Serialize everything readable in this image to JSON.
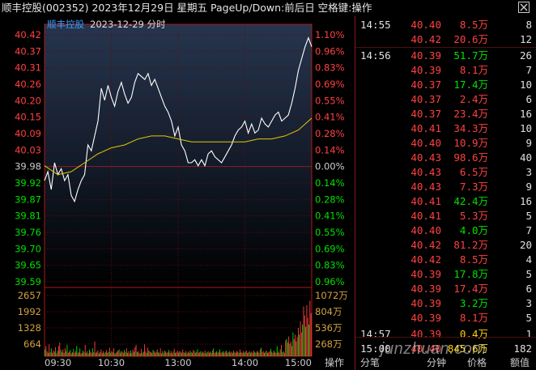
{
  "window": {
    "title": "顺丰控股(002352) 2023年12月29日 星期五 PageUp/Down:前后日 空格键:操作"
  },
  "chart_header": {
    "stock_name": "顺丰控股",
    "date_label": "2023-12-29 分时"
  },
  "chart_data": {
    "type": "line",
    "y_price_ticks": [
      "40.42",
      "40.37",
      "40.31",
      "40.26",
      "40.20",
      "40.15",
      "40.09",
      "40.03",
      "39.98",
      "39.92",
      "39.87",
      "39.81",
      "39.76",
      "39.70",
      "39.65",
      "39.59"
    ],
    "y_pct_ticks": [
      "1.10%",
      "0.96%",
      "0.83%",
      "0.69%",
      "0.55%",
      "0.41%",
      "0.28%",
      "0.14%",
      "0.00%",
      "0.14%",
      "0.28%",
      "0.41%",
      "0.55%",
      "0.69%",
      "0.83%",
      "0.96%"
    ],
    "ylim": [
      39.54,
      40.42
    ],
    "prev_close": 39.98,
    "x_ticks": [
      "09:30",
      "10:30",
      "13:00",
      "14:00",
      "15:00"
    ],
    "vol_left_ticks": [
      "2657",
      "1992",
      "1328",
      "664"
    ],
    "vol_right_ticks": [
      "1072万",
      "804万",
      "536万",
      "268万"
    ],
    "price_series": [
      [
        0,
        39.93
      ],
      [
        3,
        39.96
      ],
      [
        6,
        39.9
      ],
      [
        9,
        39.99
      ],
      [
        12,
        39.95
      ],
      [
        15,
        39.97
      ],
      [
        18,
        39.93
      ],
      [
        21,
        39.95
      ],
      [
        24,
        39.88
      ],
      [
        27,
        39.86
      ],
      [
        30,
        39.9
      ],
      [
        33,
        39.93
      ],
      [
        36,
        39.95
      ],
      [
        39,
        40.05
      ],
      [
        42,
        40.03
      ],
      [
        45,
        40.08
      ],
      [
        48,
        40.13
      ],
      [
        51,
        40.24
      ],
      [
        54,
        40.2
      ],
      [
        57,
        40.25
      ],
      [
        60,
        40.21
      ],
      [
        63,
        40.18
      ],
      [
        66,
        40.23
      ],
      [
        69,
        40.26
      ],
      [
        72,
        40.22
      ],
      [
        75,
        40.19
      ],
      [
        78,
        40.21
      ],
      [
        81,
        40.26
      ],
      [
        84,
        40.29
      ],
      [
        87,
        40.28
      ],
      [
        90,
        40.27
      ],
      [
        93,
        40.29
      ],
      [
        96,
        40.25
      ],
      [
        99,
        40.27
      ],
      [
        102,
        40.24
      ],
      [
        105,
        40.21
      ],
      [
        108,
        40.18
      ],
      [
        111,
        40.16
      ],
      [
        114,
        40.13
      ],
      [
        117,
        40.08
      ],
      [
        120,
        40.11
      ],
      [
        123,
        40.05
      ],
      [
        126,
        40.03
      ],
      [
        129,
        39.99
      ],
      [
        132,
        39.99
      ],
      [
        135,
        40.0
      ],
      [
        138,
        39.98
      ],
      [
        141,
        40.0
      ],
      [
        144,
        39.98
      ],
      [
        147,
        40.02
      ],
      [
        150,
        40.03
      ],
      [
        153,
        40.01
      ],
      [
        156,
        40.0
      ],
      [
        159,
        39.99
      ],
      [
        162,
        40.01
      ],
      [
        165,
        40.03
      ],
      [
        168,
        40.05
      ],
      [
        171,
        40.08
      ],
      [
        174,
        40.1
      ],
      [
        177,
        40.11
      ],
      [
        180,
        40.13
      ],
      [
        183,
        40.09
      ],
      [
        186,
        40.12
      ],
      [
        189,
        40.09
      ],
      [
        192,
        40.1
      ],
      [
        195,
        40.14
      ],
      [
        198,
        40.12
      ],
      [
        201,
        40.11
      ],
      [
        204,
        40.13
      ],
      [
        207,
        40.15
      ],
      [
        210,
        40.16
      ],
      [
        213,
        40.13
      ],
      [
        216,
        40.14
      ],
      [
        219,
        40.15
      ],
      [
        222,
        40.19
      ],
      [
        225,
        40.24
      ],
      [
        228,
        40.3
      ],
      [
        231,
        40.34
      ],
      [
        234,
        40.38
      ],
      [
        237,
        40.41
      ],
      [
        240,
        40.38
      ]
    ],
    "avg_series": [
      [
        0,
        39.98
      ],
      [
        12,
        39.95
      ],
      [
        24,
        39.96
      ],
      [
        36,
        39.99
      ],
      [
        48,
        40.02
      ],
      [
        60,
        40.04
      ],
      [
        72,
        40.05
      ],
      [
        84,
        40.07
      ],
      [
        96,
        40.08
      ],
      [
        108,
        40.08
      ],
      [
        120,
        40.07
      ],
      [
        132,
        40.06
      ],
      [
        144,
        40.06
      ],
      [
        156,
        40.06
      ],
      [
        168,
        40.06
      ],
      [
        180,
        40.06
      ],
      [
        192,
        40.07
      ],
      [
        204,
        40.07
      ],
      [
        216,
        40.08
      ],
      [
        228,
        40.1
      ],
      [
        240,
        40.14
      ]
    ],
    "volume_series_wan": [
      120,
      180,
      90,
      60,
      210,
      70,
      140,
      60,
      100,
      80,
      160,
      50,
      95,
      180,
      240,
      110,
      70,
      120,
      60,
      140,
      90,
      200,
      60,
      80,
      110,
      50,
      70,
      130,
      60,
      90,
      180,
      60,
      70,
      140,
      50,
      60,
      100,
      70,
      200,
      60,
      90,
      50,
      120,
      80,
      60,
      140,
      70,
      260,
      60,
      80,
      100,
      50,
      70,
      120,
      60,
      90,
      50,
      70,
      110,
      60,
      80,
      150,
      60,
      90,
      70,
      140,
      50,
      60,
      80,
      100,
      120,
      60,
      90,
      80,
      60,
      110,
      70,
      140,
      60,
      90,
      50,
      100,
      60,
      120,
      80,
      160,
      200,
      70,
      90,
      60,
      50,
      130,
      60,
      80,
      210,
      90,
      60,
      150,
      100,
      80,
      70,
      60,
      110,
      90,
      60,
      80,
      120,
      70,
      60,
      140,
      50,
      90,
      60,
      100,
      80,
      60,
      70,
      110,
      60,
      90,
      50,
      80,
      130,
      60,
      70,
      100,
      60,
      90,
      80,
      60,
      120,
      70,
      60,
      90,
      50,
      80,
      60,
      100,
      70,
      60,
      110,
      90,
      60,
      80,
      120,
      60,
      70,
      90,
      60,
      80,
      60,
      100,
      50,
      70,
      90,
      60,
      80,
      60,
      100,
      140,
      60,
      70,
      90,
      60,
      80,
      120,
      60,
      70,
      90,
      60,
      80,
      100,
      60,
      70,
      90,
      60,
      80,
      60,
      100,
      70,
      60,
      90,
      80,
      60,
      120,
      70,
      60,
      90,
      60,
      80,
      100,
      60,
      70,
      90,
      60,
      80,
      60,
      100,
      70,
      60,
      90,
      80,
      60,
      120,
      150,
      70,
      90,
      60,
      80,
      100,
      60,
      70,
      90,
      130,
      80,
      60,
      100,
      70,
      60,
      180,
      80,
      60,
      120,
      200,
      70,
      90,
      60,
      280,
      300,
      240,
      350,
      220,
      260,
      180,
      420,
      300,
      380,
      260,
      340,
      500,
      380,
      620,
      420,
      560,
      880,
      720,
      520,
      900,
      680,
      560,
      980,
      760
    ],
    "volume_colors": "alternating"
  },
  "ticks_panel": {
    "rows": [
      {
        "time": "14:55",
        "price": "40.40",
        "pc": "red",
        "vol": "8.5万",
        "vc": "red",
        "num": "8"
      },
      {
        "time": "",
        "price": "40.42",
        "pc": "red",
        "vol": "20.6万",
        "vc": "red",
        "num": "12"
      },
      {
        "time": "14:56",
        "price": "40.39",
        "pc": "red",
        "vol": "51.7万",
        "vc": "green",
        "num": "26"
      },
      {
        "time": "",
        "price": "40.39",
        "pc": "red",
        "vol": "8.1万",
        "vc": "red",
        "num": "7"
      },
      {
        "time": "",
        "price": "40.37",
        "pc": "red",
        "vol": "17.4万",
        "vc": "green",
        "num": "10"
      },
      {
        "time": "",
        "price": "40.37",
        "pc": "red",
        "vol": "2.4万",
        "vc": "red",
        "num": "6"
      },
      {
        "time": "",
        "price": "40.37",
        "pc": "red",
        "vol": "23.4万",
        "vc": "red",
        "num": "16"
      },
      {
        "time": "",
        "price": "40.41",
        "pc": "red",
        "vol": "34.3万",
        "vc": "red",
        "num": "10"
      },
      {
        "time": "",
        "price": "40.40",
        "pc": "red",
        "vol": "10.9万",
        "vc": "red",
        "num": "9"
      },
      {
        "time": "",
        "price": "40.43",
        "pc": "red",
        "vol": "98.6万",
        "vc": "red",
        "num": "40"
      },
      {
        "time": "",
        "price": "40.43",
        "pc": "red",
        "vol": "6.5万",
        "vc": "red",
        "num": "3"
      },
      {
        "time": "",
        "price": "40.43",
        "pc": "red",
        "vol": "7.3万",
        "vc": "red",
        "num": "9"
      },
      {
        "time": "",
        "price": "40.41",
        "pc": "red",
        "vol": "42.4万",
        "vc": "green",
        "num": "16"
      },
      {
        "time": "",
        "price": "40.41",
        "pc": "red",
        "vol": "5.3万",
        "vc": "red",
        "num": "5"
      },
      {
        "time": "",
        "price": "40.40",
        "pc": "red",
        "vol": "4.0万",
        "vc": "green",
        "num": "7"
      },
      {
        "time": "",
        "price": "40.42",
        "pc": "red",
        "vol": "81.2万",
        "vc": "red",
        "num": "20"
      },
      {
        "time": "",
        "price": "40.42",
        "pc": "red",
        "vol": "8.5万",
        "vc": "red",
        "num": "4"
      },
      {
        "time": "",
        "price": "40.39",
        "pc": "red",
        "vol": "17.8万",
        "vc": "green",
        "num": "5"
      },
      {
        "time": "",
        "price": "40.39",
        "pc": "red",
        "vol": "17.4万",
        "vc": "red",
        "num": "6"
      },
      {
        "time": "",
        "price": "40.39",
        "pc": "red",
        "vol": "3.2万",
        "vc": "green",
        "num": "3"
      },
      {
        "time": "",
        "price": "40.39",
        "pc": "red",
        "vol": "8.1万",
        "vc": "red",
        "num": "5"
      },
      {
        "time": "14:57",
        "price": "40.39",
        "pc": "red",
        "vol": "0.4万",
        "vc": "yellow",
        "num": "1"
      },
      {
        "time": "15:00",
        "price": "40.40",
        "pc": "red",
        "vol": "845.6万",
        "vc": "yellow",
        "num": "182"
      }
    ]
  },
  "bottom_tabs": {
    "op": "操作",
    "fenbi": "分笔",
    "fenzhong": "分钟",
    "jiage": "价格",
    "eshu": "额值"
  },
  "watermark": "junzhuan.com",
  "colors": {
    "price_line": "#ffffff",
    "avg_line": "#e6c800",
    "up": "#ff4040",
    "down": "#00e000",
    "grid": "#5a0e0e",
    "axis": "#b01818"
  }
}
